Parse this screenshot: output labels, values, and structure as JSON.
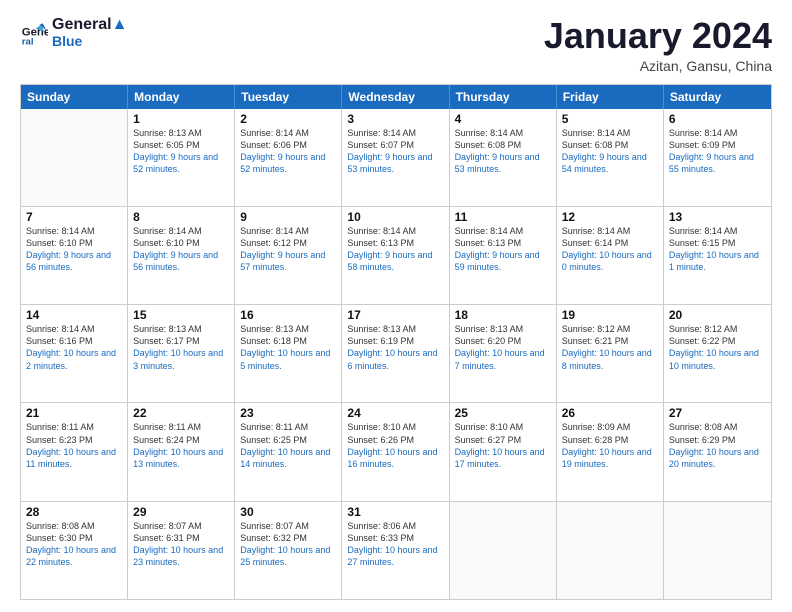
{
  "header": {
    "logo_line1": "General",
    "logo_line2": "Blue",
    "month": "January 2024",
    "location": "Azitan, Gansu, China"
  },
  "weekdays": [
    "Sunday",
    "Monday",
    "Tuesday",
    "Wednesday",
    "Thursday",
    "Friday",
    "Saturday"
  ],
  "rows": [
    [
      {
        "day": "",
        "empty": true
      },
      {
        "day": "1",
        "sunrise": "8:13 AM",
        "sunset": "6:05 PM",
        "daylight": "9 hours and 52 minutes."
      },
      {
        "day": "2",
        "sunrise": "8:14 AM",
        "sunset": "6:06 PM",
        "daylight": "9 hours and 52 minutes."
      },
      {
        "day": "3",
        "sunrise": "8:14 AM",
        "sunset": "6:07 PM",
        "daylight": "9 hours and 53 minutes."
      },
      {
        "day": "4",
        "sunrise": "8:14 AM",
        "sunset": "6:08 PM",
        "daylight": "9 hours and 53 minutes."
      },
      {
        "day": "5",
        "sunrise": "8:14 AM",
        "sunset": "6:08 PM",
        "daylight": "9 hours and 54 minutes."
      },
      {
        "day": "6",
        "sunrise": "8:14 AM",
        "sunset": "6:09 PM",
        "daylight": "9 hours and 55 minutes."
      }
    ],
    [
      {
        "day": "7",
        "sunrise": "8:14 AM",
        "sunset": "6:10 PM",
        "daylight": "9 hours and 56 minutes."
      },
      {
        "day": "8",
        "sunrise": "8:14 AM",
        "sunset": "6:10 PM",
        "daylight": "9 hours and 56 minutes."
      },
      {
        "day": "9",
        "sunrise": "8:14 AM",
        "sunset": "6:12 PM",
        "daylight": "9 hours and 57 minutes."
      },
      {
        "day": "10",
        "sunrise": "8:14 AM",
        "sunset": "6:13 PM",
        "daylight": "9 hours and 58 minutes."
      },
      {
        "day": "11",
        "sunrise": "8:14 AM",
        "sunset": "6:13 PM",
        "daylight": "9 hours and 59 minutes."
      },
      {
        "day": "12",
        "sunrise": "8:14 AM",
        "sunset": "6:14 PM",
        "daylight": "10 hours and 0 minutes."
      },
      {
        "day": "13",
        "sunrise": "8:14 AM",
        "sunset": "6:15 PM",
        "daylight": "10 hours and 1 minute."
      }
    ],
    [
      {
        "day": "14",
        "sunrise": "8:14 AM",
        "sunset": "6:16 PM",
        "daylight": "10 hours and 2 minutes."
      },
      {
        "day": "15",
        "sunrise": "8:13 AM",
        "sunset": "6:17 PM",
        "daylight": "10 hours and 3 minutes."
      },
      {
        "day": "16",
        "sunrise": "8:13 AM",
        "sunset": "6:18 PM",
        "daylight": "10 hours and 5 minutes."
      },
      {
        "day": "17",
        "sunrise": "8:13 AM",
        "sunset": "6:19 PM",
        "daylight": "10 hours and 6 minutes."
      },
      {
        "day": "18",
        "sunrise": "8:13 AM",
        "sunset": "6:20 PM",
        "daylight": "10 hours and 7 minutes."
      },
      {
        "day": "19",
        "sunrise": "8:12 AM",
        "sunset": "6:21 PM",
        "daylight": "10 hours and 8 minutes."
      },
      {
        "day": "20",
        "sunrise": "8:12 AM",
        "sunset": "6:22 PM",
        "daylight": "10 hours and 10 minutes."
      }
    ],
    [
      {
        "day": "21",
        "sunrise": "8:11 AM",
        "sunset": "6:23 PM",
        "daylight": "10 hours and 11 minutes."
      },
      {
        "day": "22",
        "sunrise": "8:11 AM",
        "sunset": "6:24 PM",
        "daylight": "10 hours and 13 minutes."
      },
      {
        "day": "23",
        "sunrise": "8:11 AM",
        "sunset": "6:25 PM",
        "daylight": "10 hours and 14 minutes."
      },
      {
        "day": "24",
        "sunrise": "8:10 AM",
        "sunset": "6:26 PM",
        "daylight": "10 hours and 16 minutes."
      },
      {
        "day": "25",
        "sunrise": "8:10 AM",
        "sunset": "6:27 PM",
        "daylight": "10 hours and 17 minutes."
      },
      {
        "day": "26",
        "sunrise": "8:09 AM",
        "sunset": "6:28 PM",
        "daylight": "10 hours and 19 minutes."
      },
      {
        "day": "27",
        "sunrise": "8:08 AM",
        "sunset": "6:29 PM",
        "daylight": "10 hours and 20 minutes."
      }
    ],
    [
      {
        "day": "28",
        "sunrise": "8:08 AM",
        "sunset": "6:30 PM",
        "daylight": "10 hours and 22 minutes."
      },
      {
        "day": "29",
        "sunrise": "8:07 AM",
        "sunset": "6:31 PM",
        "daylight": "10 hours and 23 minutes."
      },
      {
        "day": "30",
        "sunrise": "8:07 AM",
        "sunset": "6:32 PM",
        "daylight": "10 hours and 25 minutes."
      },
      {
        "day": "31",
        "sunrise": "8:06 AM",
        "sunset": "6:33 PM",
        "daylight": "10 hours and 27 minutes."
      },
      {
        "day": "",
        "empty": true
      },
      {
        "day": "",
        "empty": true
      },
      {
        "day": "",
        "empty": true
      }
    ]
  ],
  "labels": {
    "sunrise_prefix": "Sunrise: ",
    "sunset_prefix": "Sunset: ",
    "daylight_prefix": "Daylight: "
  }
}
